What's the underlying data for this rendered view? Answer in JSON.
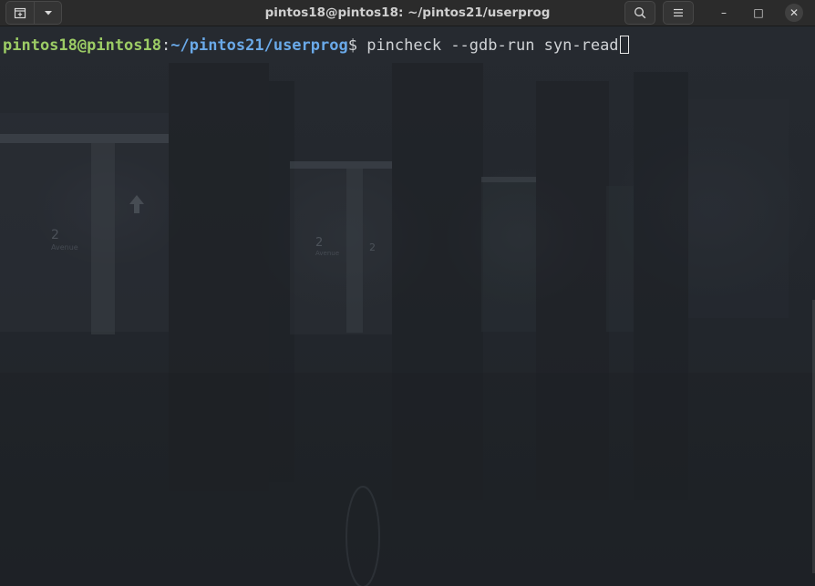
{
  "window": {
    "title": "pintos18@pintos18: ~/pintos21/userprog"
  },
  "toolbar": {
    "new_tab_icon": "new-tab-icon",
    "tab_menu_icon": "chevron-down-icon",
    "search_icon": "search-icon",
    "menu_icon": "hamburger-menu-icon",
    "minimize_glyph": "–",
    "maximize_glyph": "□",
    "close_glyph": "✕"
  },
  "terminal": {
    "prompt_user_host": "pintos18@pintos18",
    "prompt_separator": ":",
    "prompt_path": "~/pintos21/userprog",
    "prompt_symbol": "$ ",
    "command": "pincheck --gdb-run syn-read"
  },
  "background_labels": {
    "platform_left": "2",
    "platform_left_sub": "Avenue",
    "platform_mid": "2",
    "platform_mid_sub": "Avenue",
    "platform_mid2": "2"
  },
  "colors": {
    "prompt_user": "#9ccc65",
    "prompt_path": "#6aa9e8",
    "text": "#d0d3d6",
    "background": "#23272d"
  }
}
